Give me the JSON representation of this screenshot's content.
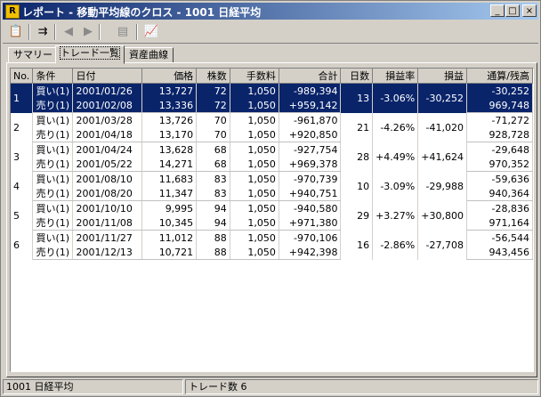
{
  "window": {
    "app_icon": "R",
    "title": "レポート - 移動平均線のクロス - 1001 日経平均",
    "minimize_label": "_",
    "maximize_label": "□",
    "close_label": "×"
  },
  "toolbar": {
    "icons": [
      "report-icon",
      "export-icon",
      "back-icon",
      "forward-icon",
      "copy-icon",
      "chart-icon"
    ]
  },
  "tabs": [
    {
      "label": "サマリー",
      "active": false
    },
    {
      "label": "トレード一覧",
      "active": true
    },
    {
      "label": "資産曲線",
      "active": false
    }
  ],
  "table": {
    "columns": [
      "No.",
      "条件",
      "日付",
      "価格",
      "株数",
      "手数料",
      "合計",
      "日数",
      "損益率",
      "損益",
      "通算/残高"
    ],
    "trades": [
      {
        "no": "1",
        "days": "13",
        "rate": "-3.06%",
        "pnl": "-30,252",
        "selected": true,
        "rows": [
          {
            "cond": "買い(1)",
            "date": "2001/01/26",
            "price": "13,727",
            "shares": "72",
            "fee": "1,050",
            "total": "-989,394",
            "balance": "-30,252"
          },
          {
            "cond": "売り(1)",
            "date": "2001/02/08",
            "price": "13,336",
            "shares": "72",
            "fee": "1,050",
            "total": "+959,142",
            "balance": "969,748"
          }
        ]
      },
      {
        "no": "2",
        "days": "21",
        "rate": "-4.26%",
        "pnl": "-41,020",
        "selected": false,
        "rows": [
          {
            "cond": "買い(1)",
            "date": "2001/03/28",
            "price": "13,726",
            "shares": "70",
            "fee": "1,050",
            "total": "-961,870",
            "balance": "-71,272"
          },
          {
            "cond": "売り(1)",
            "date": "2001/04/18",
            "price": "13,170",
            "shares": "70",
            "fee": "1,050",
            "total": "+920,850",
            "balance": "928,728"
          }
        ]
      },
      {
        "no": "3",
        "days": "28",
        "rate": "+4.49%",
        "pnl": "+41,624",
        "selected": false,
        "rows": [
          {
            "cond": "買い(1)",
            "date": "2001/04/24",
            "price": "13,628",
            "shares": "68",
            "fee": "1,050",
            "total": "-927,754",
            "balance": "-29,648"
          },
          {
            "cond": "売り(1)",
            "date": "2001/05/22",
            "price": "14,271",
            "shares": "68",
            "fee": "1,050",
            "total": "+969,378",
            "balance": "970,352"
          }
        ]
      },
      {
        "no": "4",
        "days": "10",
        "rate": "-3.09%",
        "pnl": "-29,988",
        "selected": false,
        "rows": [
          {
            "cond": "買い(1)",
            "date": "2001/08/10",
            "price": "11,683",
            "shares": "83",
            "fee": "1,050",
            "total": "-970,739",
            "balance": "-59,636"
          },
          {
            "cond": "売り(1)",
            "date": "2001/08/20",
            "price": "11,347",
            "shares": "83",
            "fee": "1,050",
            "total": "+940,751",
            "balance": "940,364"
          }
        ]
      },
      {
        "no": "5",
        "days": "29",
        "rate": "+3.27%",
        "pnl": "+30,800",
        "selected": false,
        "rows": [
          {
            "cond": "買い(1)",
            "date": "2001/10/10",
            "price": "9,995",
            "shares": "94",
            "fee": "1,050",
            "total": "-940,580",
            "balance": "-28,836"
          },
          {
            "cond": "売り(1)",
            "date": "2001/11/08",
            "price": "10,345",
            "shares": "94",
            "fee": "1,050",
            "total": "+971,380",
            "balance": "971,164"
          }
        ]
      },
      {
        "no": "6",
        "days": "16",
        "rate": "-2.86%",
        "pnl": "-27,708",
        "selected": false,
        "rows": [
          {
            "cond": "買い(1)",
            "date": "2001/11/27",
            "price": "11,012",
            "shares": "88",
            "fee": "1,050",
            "total": "-970,106",
            "balance": "-56,544"
          },
          {
            "cond": "売り(1)",
            "date": "2001/12/13",
            "price": "10,721",
            "shares": "88",
            "fee": "1,050",
            "total": "+942,398",
            "balance": "943,456"
          }
        ]
      }
    ]
  },
  "status": {
    "left": "1001 日経平均",
    "right": "トレード数 6"
  }
}
